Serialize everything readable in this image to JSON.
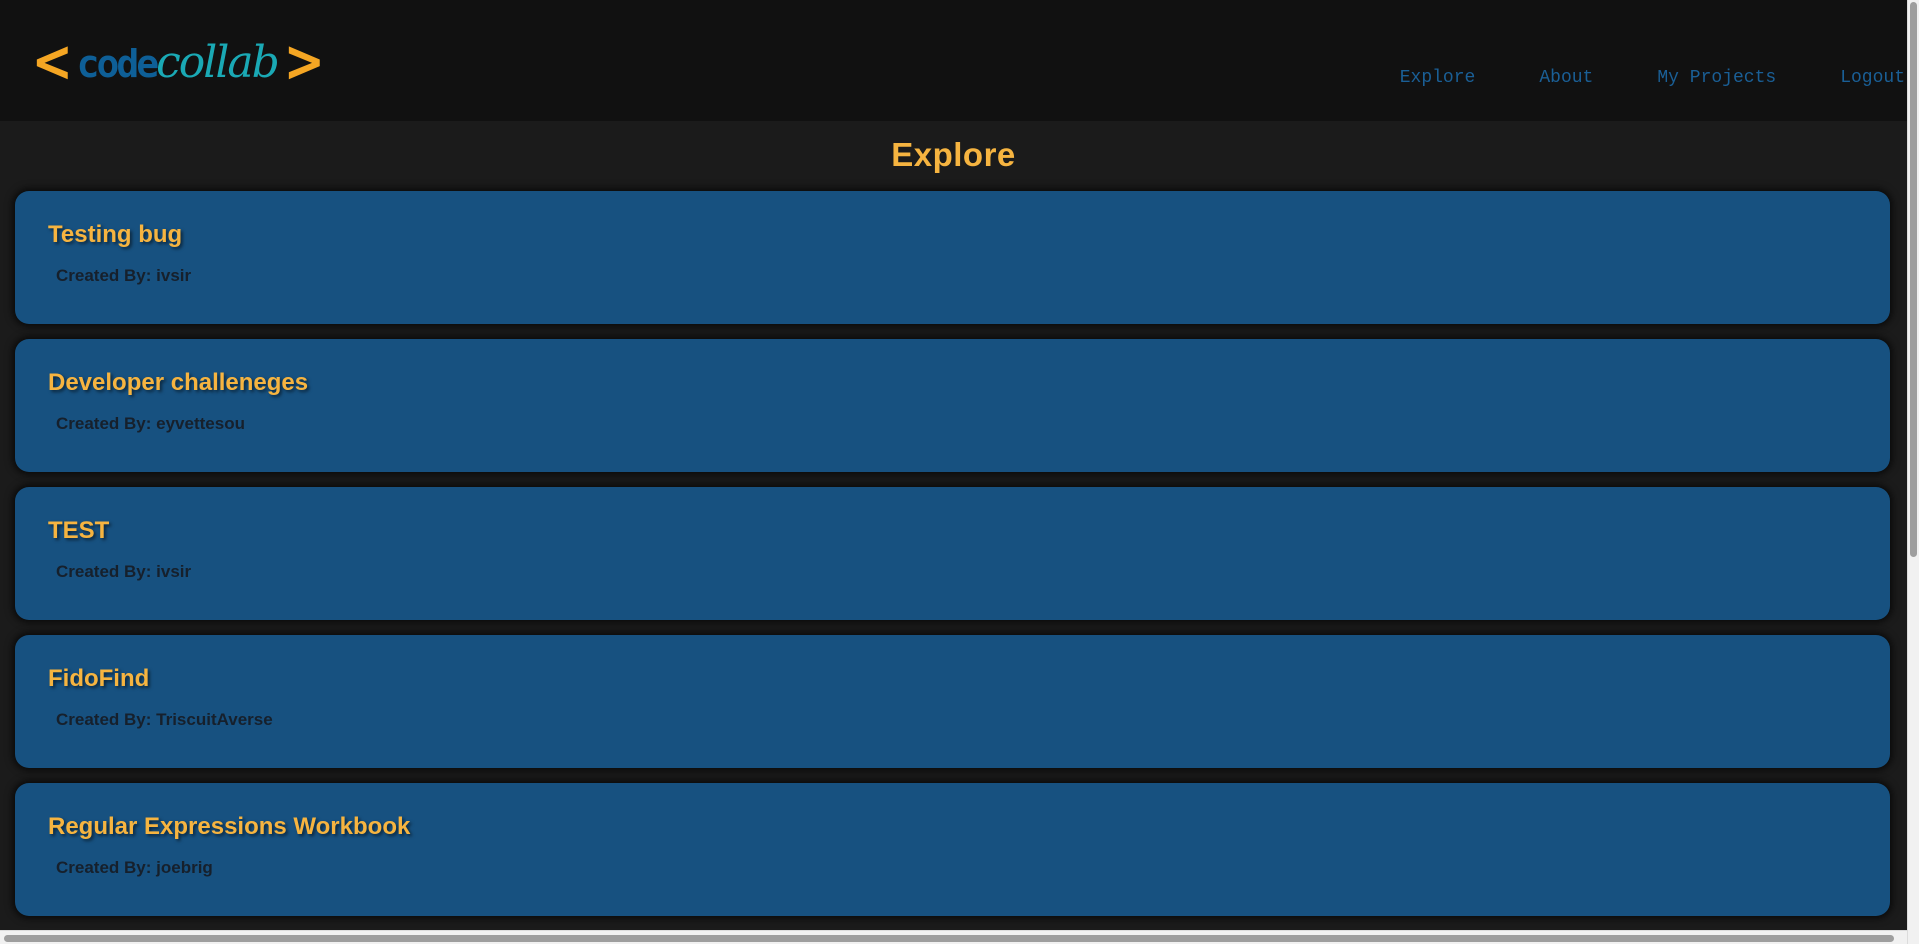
{
  "header": {
    "logo": {
      "bracket_open": "<",
      "word1": "code",
      "word2": "collab",
      "bracket_close": ">"
    },
    "nav": [
      {
        "label": "Explore"
      },
      {
        "label": "About"
      },
      {
        "label": "My Projects"
      },
      {
        "label": "Logout"
      }
    ]
  },
  "main": {
    "title": "Explore",
    "projects": [
      {
        "title": "Testing bug",
        "creator": "Created By: ivsir"
      },
      {
        "title": "Developer challeneges",
        "creator": "Created By: eyvettesou"
      },
      {
        "title": "TEST",
        "creator": "Created By: ivsir"
      },
      {
        "title": "FidoFind",
        "creator": "Created By: TriscuitAverse"
      },
      {
        "title": "Regular Expressions Workbook",
        "creator": "Created By: joebrig"
      }
    ]
  },
  "colors": {
    "accent": "#f6b440",
    "card": "#175180",
    "nav_link": "#1a5f96",
    "header_bg": "#111111",
    "page_bg": "#1b1b1b"
  }
}
